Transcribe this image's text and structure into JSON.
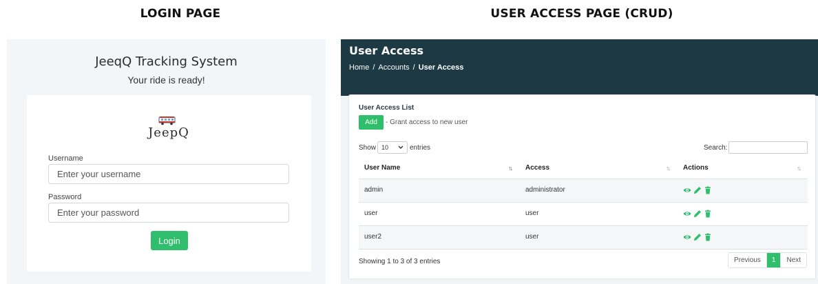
{
  "captions": {
    "login": "LOGIN PAGE",
    "user_access": "USER ACCESS PAGE (CRUD)"
  },
  "login": {
    "title": "JeeqQ Tracking System",
    "subtitle": "Your ride is ready!",
    "logo_text": "JeepQ",
    "username_label": "Username",
    "username_placeholder": "Enter your username",
    "password_label": "Password",
    "password_placeholder": "Enter your password",
    "login_button": "Login"
  },
  "user_access": {
    "title": "User Access",
    "breadcrumb": [
      "Home",
      "Accounts",
      "User Access"
    ],
    "card_title": "User Access List",
    "add_button": "Add",
    "add_description": "- Grant access to new user",
    "show_label": "Show",
    "page_size": "10",
    "entries_label": "entries",
    "search_label": "Search:",
    "search_value": "",
    "columns": [
      "User Name",
      "Access",
      "Actions"
    ],
    "rows": [
      {
        "username": "admin",
        "access": "administrator"
      },
      {
        "username": "user",
        "access": "user"
      },
      {
        "username": "user2",
        "access": "user"
      }
    ],
    "info": "Showing 1 to 3 of 3 entries",
    "pagination": {
      "previous": "Previous",
      "current": "1",
      "next": "Next"
    },
    "action_icons": [
      "eye-icon",
      "pencil-icon",
      "trash-icon"
    ]
  },
  "colors": {
    "accent_green": "#2fbe6c",
    "header_dark": "#1d3a44",
    "login_background": "#f3f6f9"
  }
}
